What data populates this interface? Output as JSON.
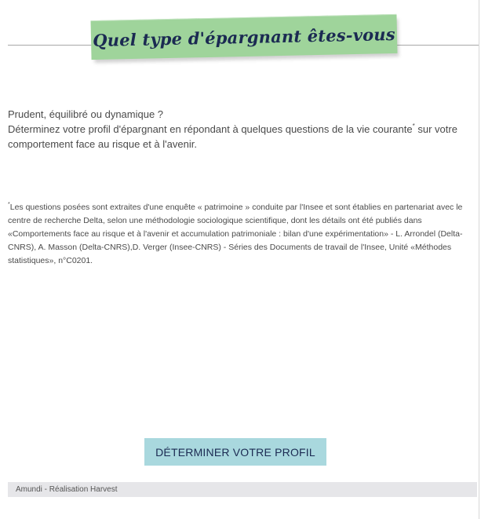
{
  "header": {
    "title": "Quel type d'épargnant êtes-vous"
  },
  "intro": {
    "line1": "Prudent, équilibré ou dynamique ?",
    "line2_before_star": "Déterminez votre profil d'épargnant en répondant à quelques questions de la vie courante",
    "star": "*",
    "line2_after_star": " sur votre comportement face au risque et à l'avenir."
  },
  "footnote": {
    "star": "*",
    "text": "Les questions posées sont extraites d'une enquête « patrimoine » conduite par l'Insee et sont établies en partenariat avec le centre de recherche Delta, selon une méthodologie sociologique scientifique, dont les détails ont été publiés dans «Comportements face au risque et à l'avenir et accumulation patrimoniale : bilan d'une expérimentation» - L. Arrondel (Delta-CNRS), A. Masson (Delta-CNRS),D. Verger (Insee-CNRS) - Séries des Documents de travail de l'Insee, Unité «Méthodes statistiques», n°C0201."
  },
  "cta": {
    "label": "DÉTERMINER VOTRE PROFIL"
  },
  "footer": {
    "text": "Amundi - Réalisation Harvest"
  },
  "colors": {
    "banner": "#9fd49b",
    "title_text": "#1b2a52",
    "button": "#a9d8de",
    "footer_bg": "#e6e6e9"
  }
}
